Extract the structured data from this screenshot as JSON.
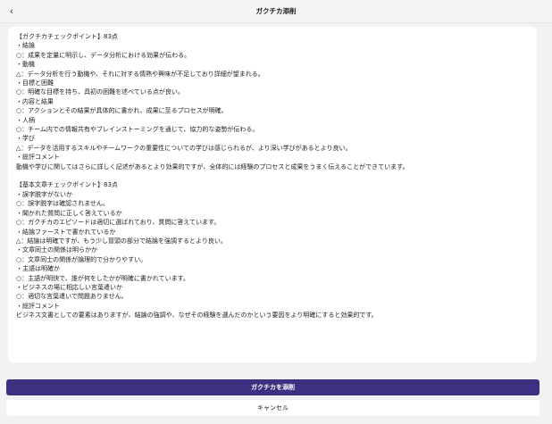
{
  "header": {
    "back_icon": "‹",
    "title": "ガクチカ添削"
  },
  "content": {
    "section1": [
      "【ガクチカチェックポイント】83点",
      "・結論",
      "○：成果を定量に明示し、データ分析における効果が伝わる。",
      "・動機",
      "△：データ分析を行う動機や、それに対する情熱や興味が不足しており詳細が望まれる。",
      "・目標と困難",
      "○：明確な目標を持ち、具初の困難を述べている点が良い。",
      "・内容と結果",
      "○：アクションとその結果が具体的に書かれ、成果に至るプロセスが明確。",
      "・人柄",
      "○：チーム内での情報共有やブレインストーミングを通じて、協力的な姿勢が伝わる。",
      "・学び",
      "△：データを活用するスキルやチームワークの重要性についての学びは感じられるが、より深い学びがあるとより良い。",
      "・総評コメント",
      "動機や学びに関してはさらに詳しく記述があるとより効果的ですが、全体的には経験のプロセスと成果をうまく伝えることができています。"
    ],
    "section2": [
      "【基本文章チェックポイント】83点",
      "・誤字脱字がないか",
      "○：誤字脱字は確認されません。",
      "・聞かれた質問に正しく答えているか",
      "○：ガクチカのエピソードは適切に選ばれており、質問に答えています。",
      "・結論ファーストで書かれているか",
      "△：結論は明確ですが、もう少し冒頭の部分で結論を強調するとより良い。",
      "・文章同士の関係は明らかか",
      "○：文章同士の関係が論理的で分かりやすい。",
      "・主語は明確か",
      "○：主語が明快で、誰が何をしたかが明確に書かれています。",
      "・ビジネスの場に相応しい言葉遣いか",
      "○：適切な言葉遣いで問題ありません。",
      "・総評コメント",
      "ビジネス文書としての要素はありますが、結論の強調や、なぜその経験を選んだのかという要因をより明確にすると効果的です。"
    ]
  },
  "actions": {
    "primary_label": "ガクチカを添削",
    "secondary_label": "キャンセル"
  },
  "colors": {
    "primary": "#3b3180",
    "background": "#f2f2f4",
    "card": "#ffffff"
  }
}
